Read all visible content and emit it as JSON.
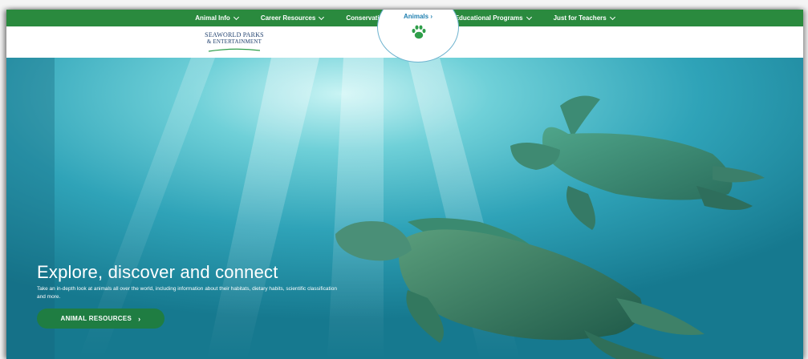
{
  "nav": {
    "items": [
      {
        "label": "Animal Info"
      },
      {
        "label": "Career Resources"
      },
      {
        "label": "Conservation & Research"
      },
      {
        "label": "Educational Programs"
      },
      {
        "label": "Just for Teachers"
      }
    ]
  },
  "header": {
    "logo_line1": "SEAWORLD PARKS",
    "logo_line2": "& ENTERTAINMENT",
    "animals_tab_label": "Animals ›",
    "paw_icon": "paw-icon"
  },
  "hero": {
    "title": "Explore, discover and connect",
    "description": "Take an in-depth look at animals all over the world, including information about their habitats, dietary habits, scientific classification and more.",
    "cta_label": "ANIMAL RESOURCES",
    "cta_arrow": "›"
  },
  "colors": {
    "nav_green": "#2a8a3e",
    "cta_green": "#1f7d42",
    "animals_blue": "#1f7fb0",
    "logo_navy": "#1d3e6c",
    "water": "#2b9fb3"
  }
}
